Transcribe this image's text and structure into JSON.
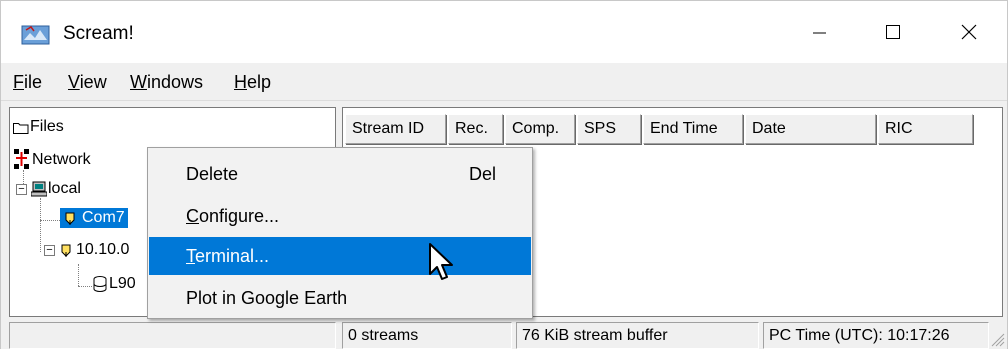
{
  "window": {
    "title": "Scream!",
    "controls": {
      "minimize": "—",
      "maximize": "☐",
      "close": "✕"
    }
  },
  "menu": [
    {
      "accel": "F",
      "rest": "ile"
    },
    {
      "accel": "V",
      "rest": "iew"
    },
    {
      "accel": "W",
      "rest": "indows"
    },
    {
      "accel": "H",
      "rest": "elp"
    }
  ],
  "tree": {
    "files": "Files",
    "network": "Network",
    "local": "local",
    "com7": "Com7",
    "ip_node": "10.10.0",
    "child": "L90"
  },
  "table": {
    "columns": [
      "Stream ID",
      "Rec.",
      "Comp.",
      "SPS",
      "End Time",
      "Date",
      "RIC"
    ]
  },
  "context_menu": {
    "items": [
      {
        "label": "Delete",
        "shortcut": "Del"
      },
      {
        "accel": "C",
        "rest": "onfigure..."
      },
      {
        "accel": "T",
        "rest": "erminal...",
        "highlighted": true
      },
      {
        "label": "Plot in Google Earth"
      }
    ]
  },
  "status": {
    "cell1": "",
    "streams": "0 streams",
    "buffer": "76 KiB stream buffer",
    "time": "PC Time (UTC):  10:17:26"
  },
  "colors": {
    "selection": "#0078d7",
    "window_bg": "#f0f0f0"
  }
}
